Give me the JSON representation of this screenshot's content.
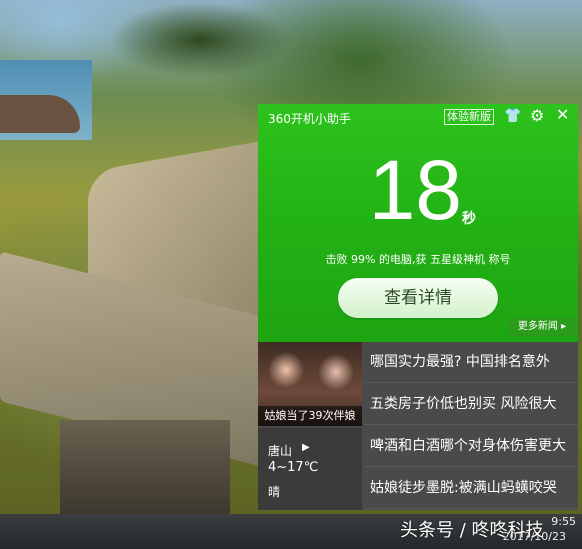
{
  "assistant": {
    "title": "360开机小助手",
    "badge": "体验新版",
    "boot_time": "18",
    "boot_unit": "秒",
    "summary": "击败 99% 的电脑,获 五星级神机 称号",
    "detail_button": "查看详情",
    "more_news": "更多新闻",
    "photo_caption": "姑娘当了39次伴娘",
    "weather": {
      "city": "唐山",
      "temp": "4~17℃",
      "condition": "晴"
    },
    "news": [
      "哪国实力最强? 中国排名意外",
      "五类房子价低也别买 风险很大",
      "啤酒和白酒哪个对身体伤害更大",
      "姑娘徒步墨脱:被满山蚂蟥咬哭"
    ]
  },
  "taskbar": {
    "watermark": "头条号 / 咚咚科技",
    "time": "9:55",
    "date": "2017/10/23"
  },
  "icons": {
    "shirt": "shirt-icon",
    "gear": "gear-icon",
    "close": "close-icon"
  },
  "colors": {
    "panel_green": "#22b014",
    "news_bg": "#4a4a4a"
  }
}
